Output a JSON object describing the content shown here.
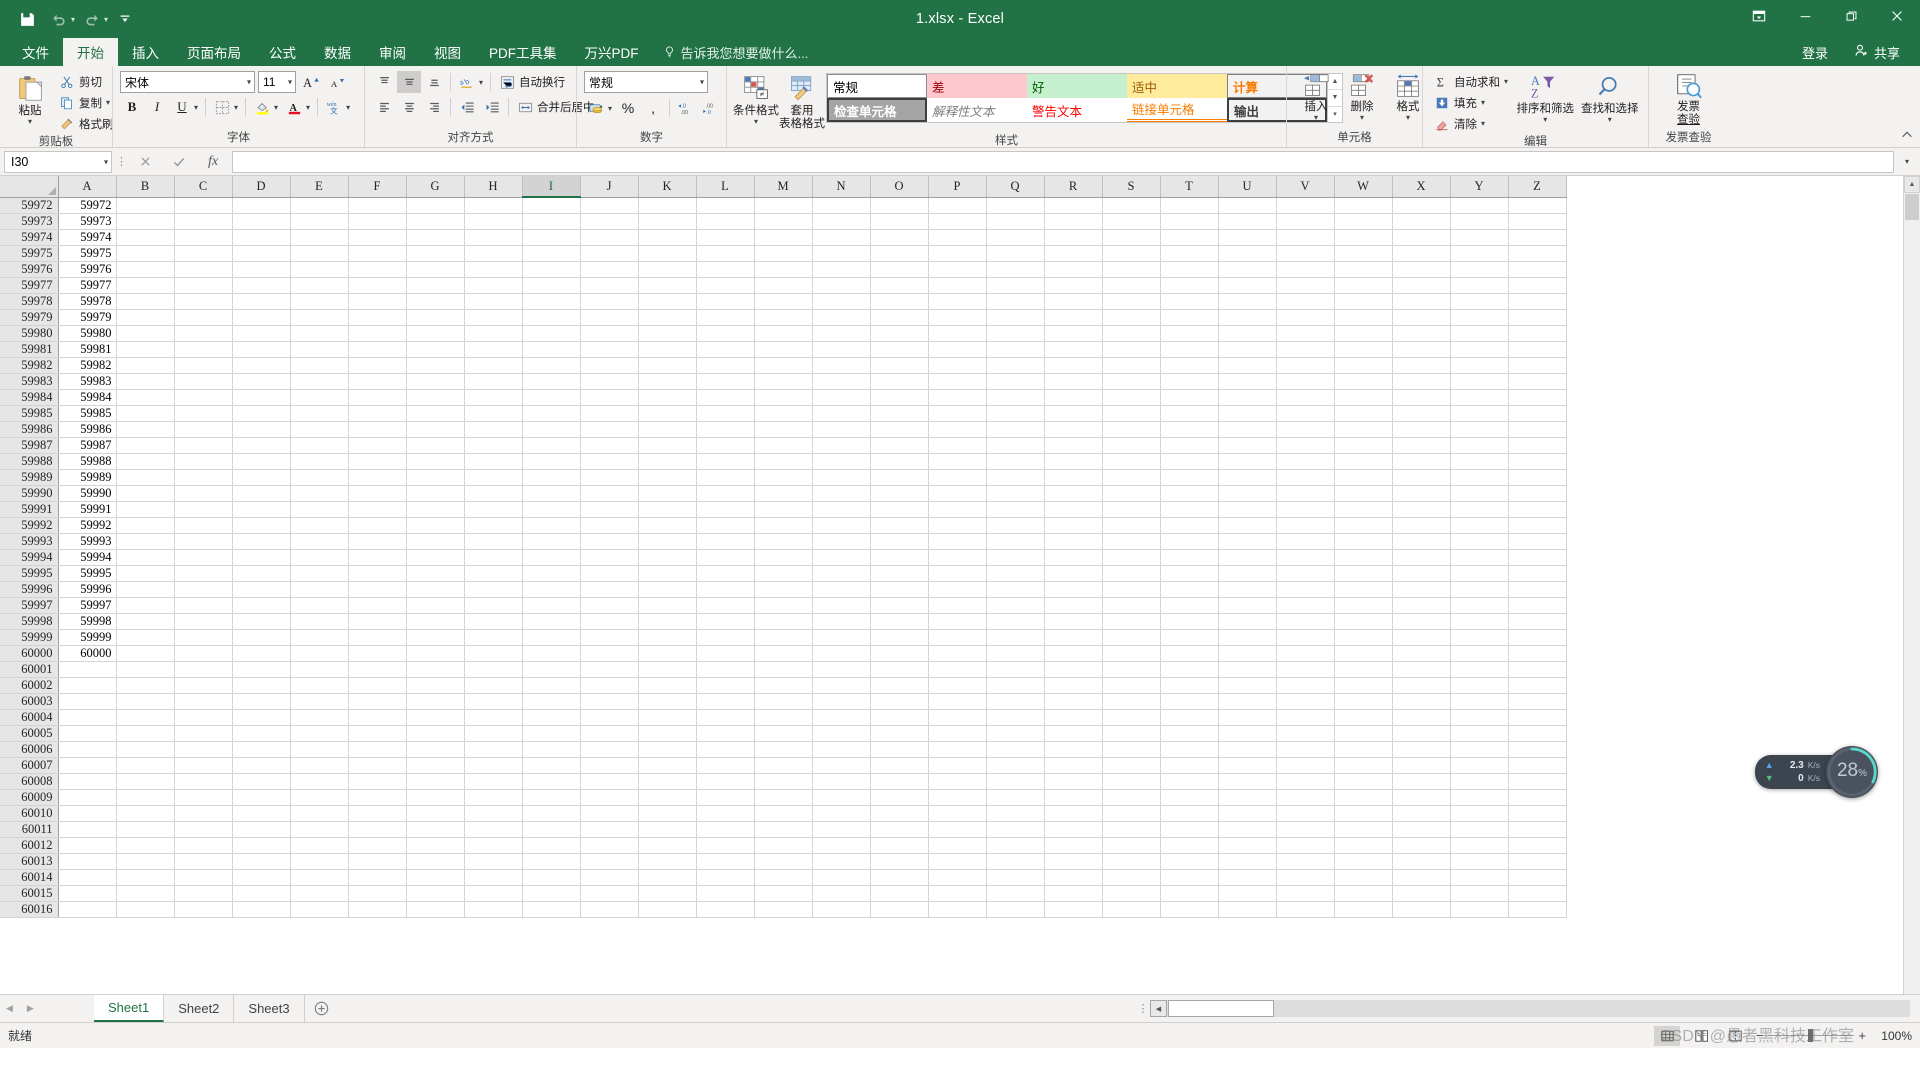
{
  "window": {
    "title": "1.xlsx - Excel",
    "controls": {
      "ribbon_display": "ribbon-display-options-icon",
      "minimize": "minimize-icon",
      "restore": "restore-icon",
      "close": "close-icon"
    }
  },
  "quick_access": {
    "save": "save-icon",
    "undo": "undo-icon",
    "redo": "redo-icon",
    "customize": "customize-qat-icon"
  },
  "ribbon": {
    "tabs": [
      {
        "label": "文件",
        "active": false
      },
      {
        "label": "开始",
        "active": true
      },
      {
        "label": "插入",
        "active": false
      },
      {
        "label": "页面布局",
        "active": false
      },
      {
        "label": "公式",
        "active": false
      },
      {
        "label": "数据",
        "active": false
      },
      {
        "label": "审阅",
        "active": false
      },
      {
        "label": "视图",
        "active": false
      },
      {
        "label": "PDF工具集",
        "active": false
      },
      {
        "label": "万兴PDF",
        "active": false
      }
    ],
    "tell_me": "告诉我您想要做什么...",
    "sign_in": "登录",
    "share": "共享",
    "collapse": "collapse-ribbon-icon",
    "groups": {
      "clipboard": {
        "label": "剪贴板",
        "paste": "粘贴",
        "cut": "剪切",
        "copy": "复制",
        "format_painter": "格式刷"
      },
      "font": {
        "label": "字体",
        "font_name": "宋体",
        "font_size": "11",
        "grow_font": "增大字号",
        "shrink_font": "减小字号",
        "bold": "B",
        "italic": "I",
        "underline": "U",
        "borders": "边框",
        "fill_color": "填充颜色",
        "font_color": "字体颜色",
        "phonetic": "拼音指南"
      },
      "alignment": {
        "label": "对齐方式",
        "top_align": "顶端对齐",
        "middle_align": "垂直居中",
        "bottom_align": "底端对齐",
        "orientation": "方向",
        "wrap_text": "自动换行",
        "align_left": "左对齐",
        "align_center": "居中",
        "align_right": "右对齐",
        "decrease_indent": "减少缩进量",
        "increase_indent": "增加缩进量",
        "merge_center": "合并后居中"
      },
      "number": {
        "label": "数字",
        "format": "常规",
        "accounting": "会计数字格式",
        "percent": "%",
        "comma": ",",
        "increase_decimal": "增加小数位数",
        "decrease_decimal": "减少小数位数"
      },
      "styles": {
        "label": "样式",
        "conditional": "条件格式",
        "format_table_line1": "套用",
        "format_table_line2": "表格格式",
        "gallery": [
          {
            "label": "常规",
            "fg": "#000000",
            "bg": "#ffffff",
            "border": "#8c8c8c",
            "bold": false,
            "italic": false
          },
          {
            "label": "差",
            "fg": "#9c0006",
            "bg": "#ffc7ce",
            "border": "",
            "bold": false,
            "italic": false
          },
          {
            "label": "好",
            "fg": "#006100",
            "bg": "#c6efce",
            "border": "",
            "bold": false,
            "italic": false
          },
          {
            "label": "适中",
            "fg": "#9c5700",
            "bg": "#ffeb9c",
            "border": "",
            "bold": false,
            "italic": false
          },
          {
            "label": "计算",
            "fg": "#fa7d00",
            "bg": "#f2f2f2",
            "border": "#7f7f7f",
            "bold": true,
            "italic": false
          },
          {
            "label": "检查单元格",
            "fg": "#ffffff",
            "bg": "#a5a5a5",
            "border": "#3f3f3f",
            "bold": true,
            "italic": false
          },
          {
            "label": "解释性文本",
            "fg": "#7f7f7f",
            "bg": "#ffffff",
            "border": "",
            "bold": false,
            "italic": true
          },
          {
            "label": "警告文本",
            "fg": "#ff0000",
            "bg": "#ffffff",
            "border": "",
            "bold": false,
            "italic": false
          },
          {
            "label": "链接单元格",
            "fg": "#fa7d00",
            "bg": "#ffffff",
            "border": "",
            "bold": false,
            "italic": false
          },
          {
            "label": "输出",
            "fg": "#3f3f3f",
            "bg": "#f2f2f2",
            "border": "#3f3f3f",
            "bold": true,
            "italic": false
          }
        ]
      },
      "cells": {
        "label": "单元格",
        "insert": "插入",
        "delete": "删除",
        "format": "格式"
      },
      "editing": {
        "label": "编辑",
        "autosum": "自动求和",
        "fill": "填充",
        "clear": "清除",
        "sort_filter": "排序和筛选",
        "find_select": "查找和选择"
      },
      "invoice": {
        "label": "发票查验",
        "button_line1": "发票",
        "button_line2": "查验"
      }
    }
  },
  "formula_bar": {
    "name_box": "I30",
    "cancel": "cancel-icon",
    "enter": "enter-icon",
    "insert_function": "fx",
    "value": "",
    "expand": "expand-formula-bar-icon"
  },
  "grid": {
    "columns": [
      "A",
      "B",
      "C",
      "D",
      "E",
      "F",
      "G",
      "H",
      "I",
      "J",
      "K",
      "L",
      "M",
      "N",
      "O",
      "P",
      "Q",
      "R",
      "S",
      "T",
      "U",
      "V",
      "W",
      "X",
      "Y",
      "Z"
    ],
    "selected_column": "I",
    "first_visible_row": 59972,
    "last_visible_row": 60016,
    "last_data_row": 60000,
    "data_column": "A",
    "column_widths": {
      "row_header": 58,
      "A": 58,
      "default": 58
    }
  },
  "net_widget": {
    "upload_value": "2.3",
    "upload_unit": "K/s",
    "download_value": "0",
    "download_unit": "K/s",
    "percent": "28",
    "percent_sign": "%",
    "gauge_color": "#5ad8c8"
  },
  "sheet_tabs": {
    "prev": "prev-sheet-icon",
    "next": "next-sheet-icon",
    "tabs": [
      {
        "label": "Sheet1",
        "active": true
      },
      {
        "label": "Sheet2",
        "active": false
      },
      {
        "label": "Sheet3",
        "active": false
      }
    ],
    "add": "add-sheet-icon"
  },
  "status_bar": {
    "state": "就绪",
    "normal_view": "normal-view-icon",
    "page_layout_view": "page-layout-view-icon",
    "page_break_view": "page-break-preview-icon",
    "zoom_out": "−",
    "zoom_in": "+",
    "zoom_level": "100%"
  },
  "watermark": {
    "text": "CSDN @愚者黑科技工作室"
  }
}
